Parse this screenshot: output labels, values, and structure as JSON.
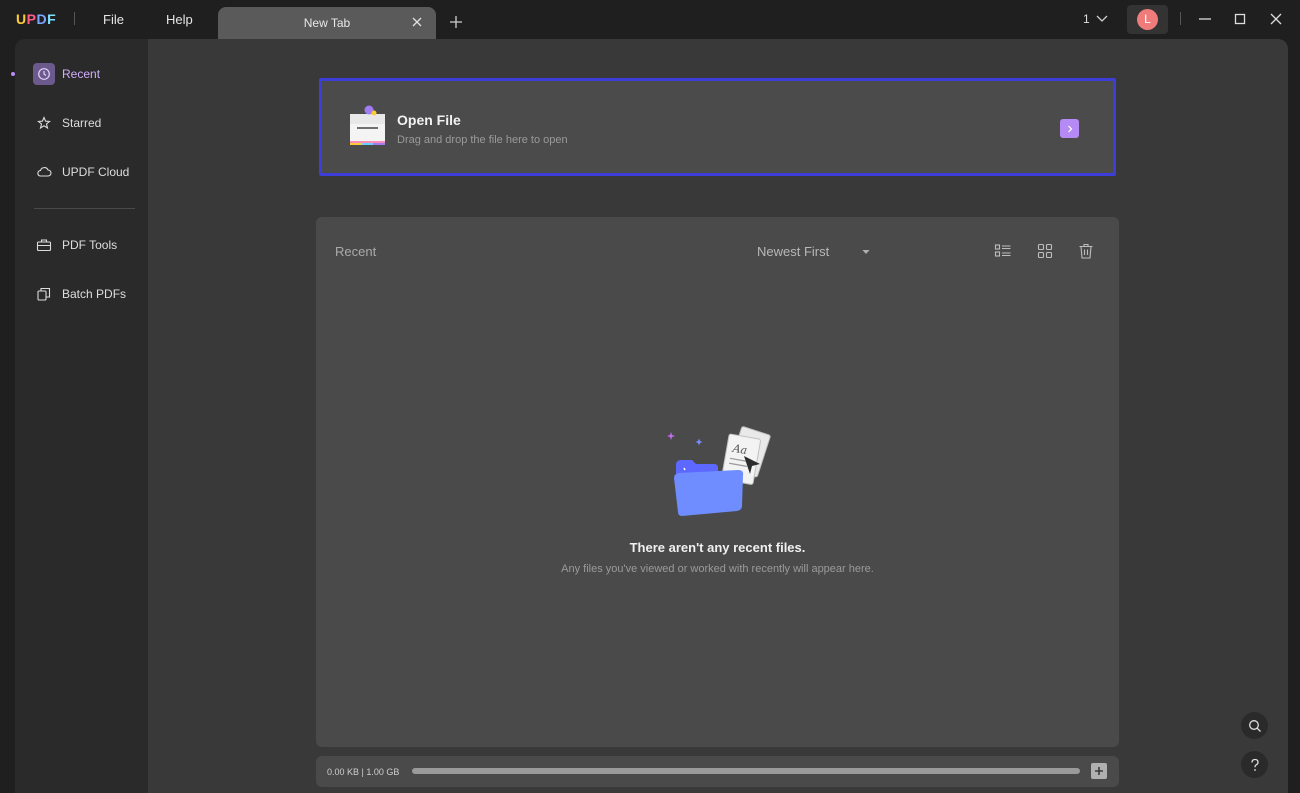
{
  "app": {
    "logo": {
      "u": "U",
      "p": "P",
      "d": "D",
      "f": "F"
    },
    "menu": {
      "file": "File",
      "help": "Help"
    },
    "tab": {
      "label": "New Tab"
    },
    "page_indicator": "1",
    "user_initial": "L"
  },
  "sidebar": {
    "items": [
      {
        "label": "Recent",
        "icon": "clock-icon",
        "active": true
      },
      {
        "label": "Starred",
        "icon": "star-icon"
      },
      {
        "label": "UPDF Cloud",
        "icon": "cloud-icon"
      },
      {
        "label": "PDF Tools",
        "icon": "toolbox-icon"
      },
      {
        "label": "Batch PDFs",
        "icon": "batch-icon"
      }
    ]
  },
  "open_file": {
    "title": "Open File",
    "subtitle": "Drag and drop the file here to open"
  },
  "recent": {
    "title": "Recent",
    "sort": "Newest First",
    "empty_title": "There aren't any recent files.",
    "empty_subtitle": "Any files you've viewed or worked with recently will appear here."
  },
  "storage": {
    "label": "0.00 KB | 1.00 GB",
    "used_fraction": 0.0
  },
  "colors": {
    "accent": "#b58af5",
    "highlight_border": "#3d3dd9",
    "avatar": "#f07b7b"
  }
}
